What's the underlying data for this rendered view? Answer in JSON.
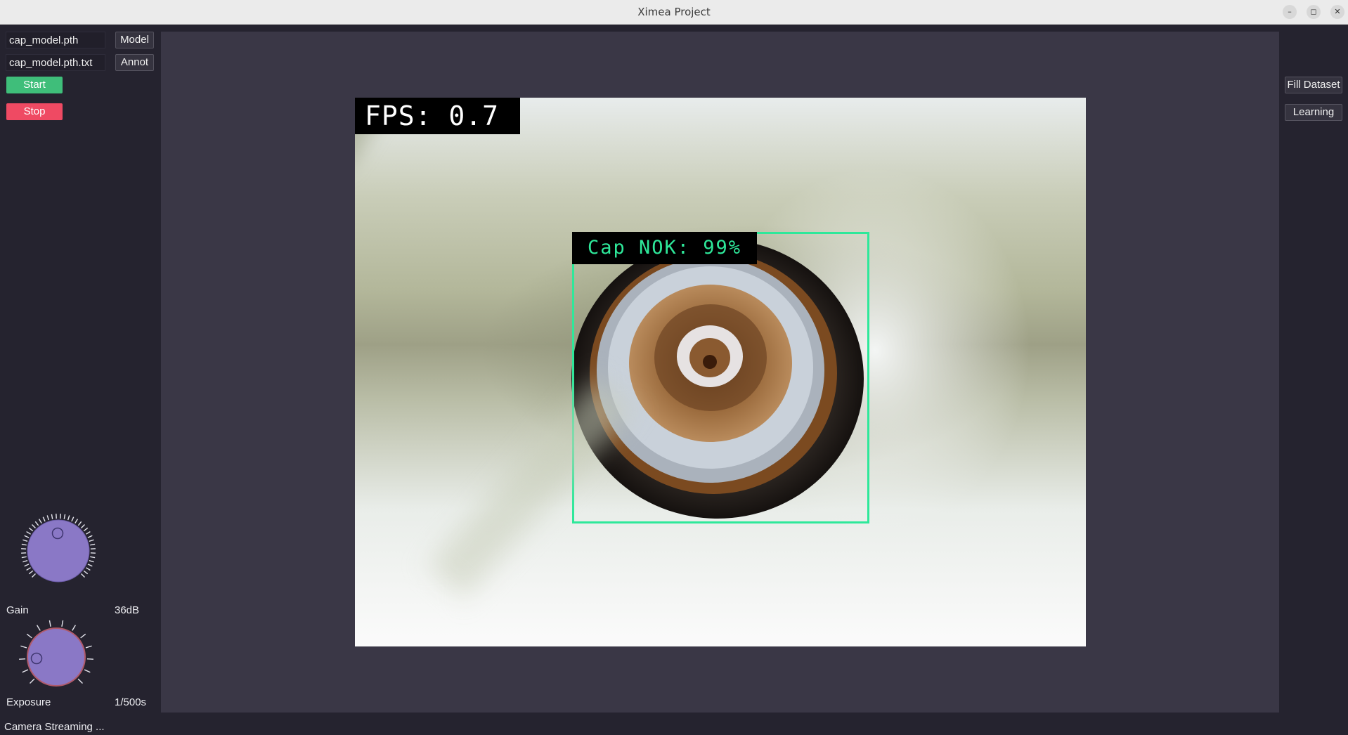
{
  "window": {
    "title": "Ximea Project",
    "controls": [
      "minimize",
      "maximize",
      "close"
    ]
  },
  "left_panel": {
    "model_file": "cap_model.pth",
    "model_button": "Model",
    "annot_file": "cap_model.pth.txt",
    "annot_button": "Annot",
    "start_button": "Start",
    "stop_button": "Stop",
    "gain": {
      "label": "Gain",
      "value": "36dB"
    },
    "exposure": {
      "label": "Exposure",
      "value": "1/500s"
    }
  },
  "right_panel": {
    "fill_dataset_button": "Fill Dataset",
    "learning_button": "Learning"
  },
  "camera_view": {
    "fps_text": "FPS: 0.7",
    "detection_label": "Cap NOK: 99%"
  },
  "status": "Camera Streaming ...",
  "colors": {
    "start": "#3fbe7a",
    "stop": "#ef4a63",
    "detection": "#2ee89a",
    "knob": "#8a78c6",
    "panel_bg": "#25232f",
    "viewport_bg": "#3a3746"
  }
}
